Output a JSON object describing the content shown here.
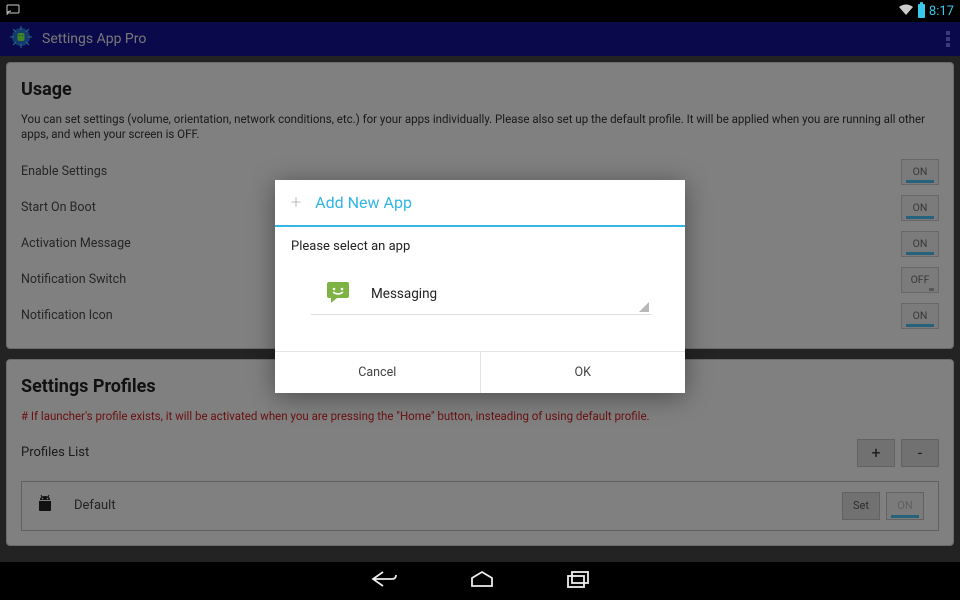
{
  "statusbar": {
    "time": "8:17"
  },
  "appbar": {
    "title": "Settings App Pro"
  },
  "usage": {
    "heading": "Usage",
    "description": "You can set settings (volume, orientation, network conditions, etc.) for your apps individually. Please also set up the default profile. It will be applied when you are running all other apps, and when your screen is OFF.",
    "items": [
      {
        "label": "Enable Settings",
        "state": "ON"
      },
      {
        "label": "Start On Boot",
        "state": "ON"
      },
      {
        "label": "Activation Message",
        "state": "ON"
      },
      {
        "label": "Notification Switch",
        "state": "OFF"
      },
      {
        "label": "Notification Icon",
        "state": "ON"
      }
    ]
  },
  "profiles": {
    "heading": "Settings Profiles",
    "note": "# If launcher's profile exists, it will be activated when you are pressing the \"Home\" button, insteading of using default profile.",
    "list_label": "Profiles List",
    "add_label": "+",
    "remove_label": "-",
    "items": [
      {
        "name": "Default",
        "set_label": "Set",
        "state": "ON"
      }
    ]
  },
  "dialog": {
    "title": "Add New App",
    "prompt": "Please select an app",
    "selected_app": "Messaging",
    "cancel": "Cancel",
    "ok": "OK"
  }
}
